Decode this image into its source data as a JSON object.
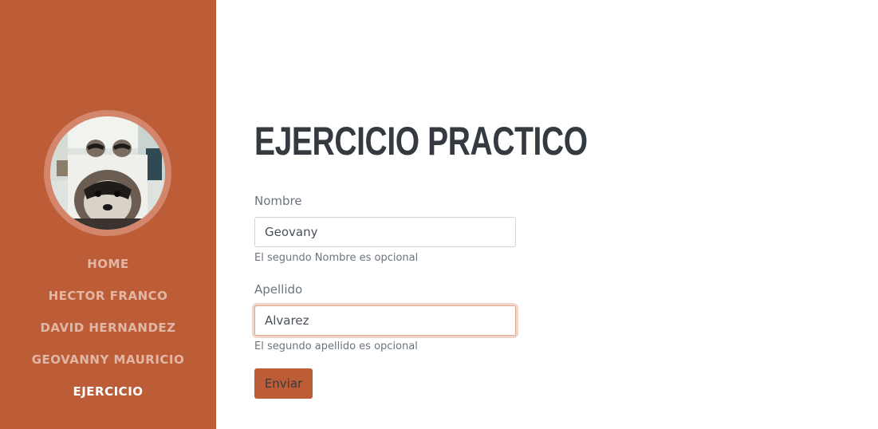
{
  "sidebar": {
    "avatar_alt": "raccoon photo",
    "nav": [
      {
        "label": "HOME"
      },
      {
        "label": "HECTOR FRANCO"
      },
      {
        "label": "DAVID HERNANDEZ"
      },
      {
        "label": "GEOVANNY MAURICIO"
      },
      {
        "label": "EJERCICIO",
        "active": true
      }
    ]
  },
  "main": {
    "title": "EJERCICIO PRACTICO",
    "form": {
      "nombre": {
        "label": "Nombre",
        "value": "Geovany",
        "help": "El segundo Nombre es opcional"
      },
      "apellido": {
        "label": "Apellido",
        "value": "Alvarez",
        "help": "El segundo apellido es opcional"
      },
      "submit_label": "Enviar"
    }
  },
  "colors": {
    "sidebar_bg": "#bd5d38",
    "heading": "#343a40",
    "muted": "#6c757d"
  }
}
